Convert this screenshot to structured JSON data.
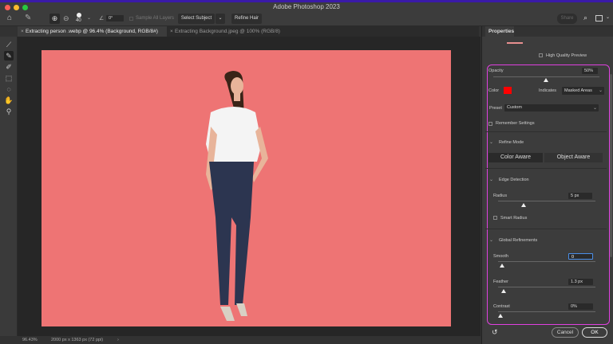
{
  "app": {
    "title": "Adobe Photoshop 2023",
    "accent": "#e040e0"
  },
  "options": {
    "brush_size": "40",
    "angle": "0°",
    "sample_all_layers": "Sample All Layers",
    "select_subject": "Select Subject",
    "refine_hair": "Refine Hair",
    "share": "Share"
  },
  "tabs": [
    {
      "label": "Extracting person .webp @ 96.4% (Background, RGB/8#)",
      "active": true
    },
    {
      "label": "Extracting Background.jpeg @ 100% (RGB/8)",
      "active": false
    }
  ],
  "status": {
    "zoom": "96.43%",
    "doc_info": "2000 px x 1363 px (72 ppi)"
  },
  "properties": {
    "title": "Properties",
    "high_quality_preview": "High Quality Preview",
    "opacity_label": "Opacity",
    "opacity_value": "50%",
    "opacity_level": 0.5,
    "color_label": "Color",
    "color_value": "#ff0000",
    "indicates_label": "Indicates",
    "indicates_value": "Masked Areas",
    "preset_label": "Preset",
    "preset_value": "Custom",
    "remember_settings": "Remember Settings",
    "refine_mode": {
      "title": "Refine Mode",
      "color_aware": "Color Aware",
      "object_aware": "Object Aware"
    },
    "edge_detection": {
      "title": "Edge Detection",
      "radius_label": "Radius",
      "radius_value": "5 px",
      "smart_radius": "Smart Radius"
    },
    "global_refinements": {
      "title": "Global Refinements",
      "smooth_label": "Smooth",
      "smooth_value": "0",
      "feather_label": "Feather",
      "feather_value": "1.3 px",
      "contrast_label": "Contrast",
      "contrast_value": "0%"
    },
    "cancel": "Cancel",
    "ok": "OK"
  }
}
